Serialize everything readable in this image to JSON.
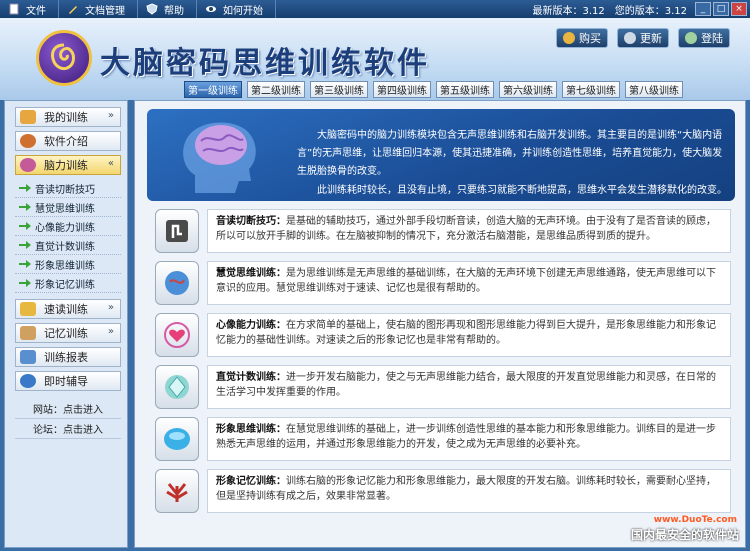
{
  "menubar": {
    "file": "文件",
    "docs": "文档管理",
    "help": "帮助",
    "start": "如何开始",
    "latest_version": "最新版本：3.12",
    "your_version": "您的版本：3.12",
    "minimize": "_",
    "maximize": "□",
    "close": "×"
  },
  "header": {
    "title": "大脑密码思维训练软件",
    "buy": "购买",
    "update": "更新",
    "login": "登陆"
  },
  "tabs": [
    "第一级训练",
    "第二级训练",
    "第三级训练",
    "第四级训练",
    "第五级训练",
    "第六级训练",
    "第七级训练",
    "第八级训练"
  ],
  "sidebar": {
    "my_training": "我的训练",
    "intro": "软件介绍",
    "brain_training": "脑力训练",
    "sub": [
      "音读切断技巧",
      "慧觉思维训练",
      "心像能力训练",
      "直觉计数训练",
      "形象思维训练",
      "形象记忆训练"
    ],
    "speed_reading": "速读训练",
    "memory": "记忆训练",
    "report": "训练报表",
    "coach": "即时辅导",
    "website": "网站：点击进入",
    "forum": "论坛：点击进入"
  },
  "intro": {
    "para1": "大脑密码中的脑力训练模块包含无声思维训练和右脑开发训练。其主要目的是训练“大脑内语言”的无声思维，让思维回归本源，使其迅捷准确，并训练创造性思维，培养直觉能力，使大脑发生脱胎换骨的改变。",
    "para2": "此训练耗时较长，且没有止境，只要练习就能不断地提高，思维水平会发生潜移默化的改变。"
  },
  "rows": [
    {
      "title": "音读切断技巧：",
      "text": "是基础的辅助技巧，通过外部手段切断音读，创造大脑的无声环境。由于没有了是否音读的顾虑，所以可以放开手脚的训练。在左脑被抑制的情况下，充分激活右脑潜能，是思维品质得到质的提升。"
    },
    {
      "title": "慧觉思维训练：",
      "text": "是为思维训练是无声思维的基础训练，在大脑的无声环境下创建无声思维通路，使无声思维可以下意识的应用。慧觉思维训练对于速读、记忆也是很有帮助的。"
    },
    {
      "title": "心像能力训练：",
      "text": "在方求简单的基础上，使右脑的图形再现和图形思维能力得到巨大提升，是形象思维能力和形象记忆能力的基础性训练。对速读之后的形象记忆也是非常有帮助的。"
    },
    {
      "title": "直觉计数训练：",
      "text": "进一步开发右脑能力，使之与无声思维能力结合，最大限度的开发直觉思维能力和灵感，在日常的生活学习中发挥重要的作用。"
    },
    {
      "title": "形象思维训练：",
      "text": "在慧觉思维训练的基础上，进一步训练创造性思维的基本能力和形象思维能力。训练目的是进一步熟悉无声思维的运用，并通过形象思维能力的开发，使之成为无声思维的必要补充。"
    },
    {
      "title": "形象记忆训练：",
      "text": "训练右脑的形象记忆能力和形象思维能力，最大限度的开发右脑。训练耗时较长，需要耐心坚持，但是坚持训练有成之后，效果非常显著。"
    }
  ],
  "watermark": {
    "site": "www.DuoTe.com",
    "brand": "国内最安全的软件站"
  },
  "colors": {
    "accent": "#2c64ad",
    "intro_bg": "#1a4c94",
    "logo_ring": "#f0c040"
  }
}
